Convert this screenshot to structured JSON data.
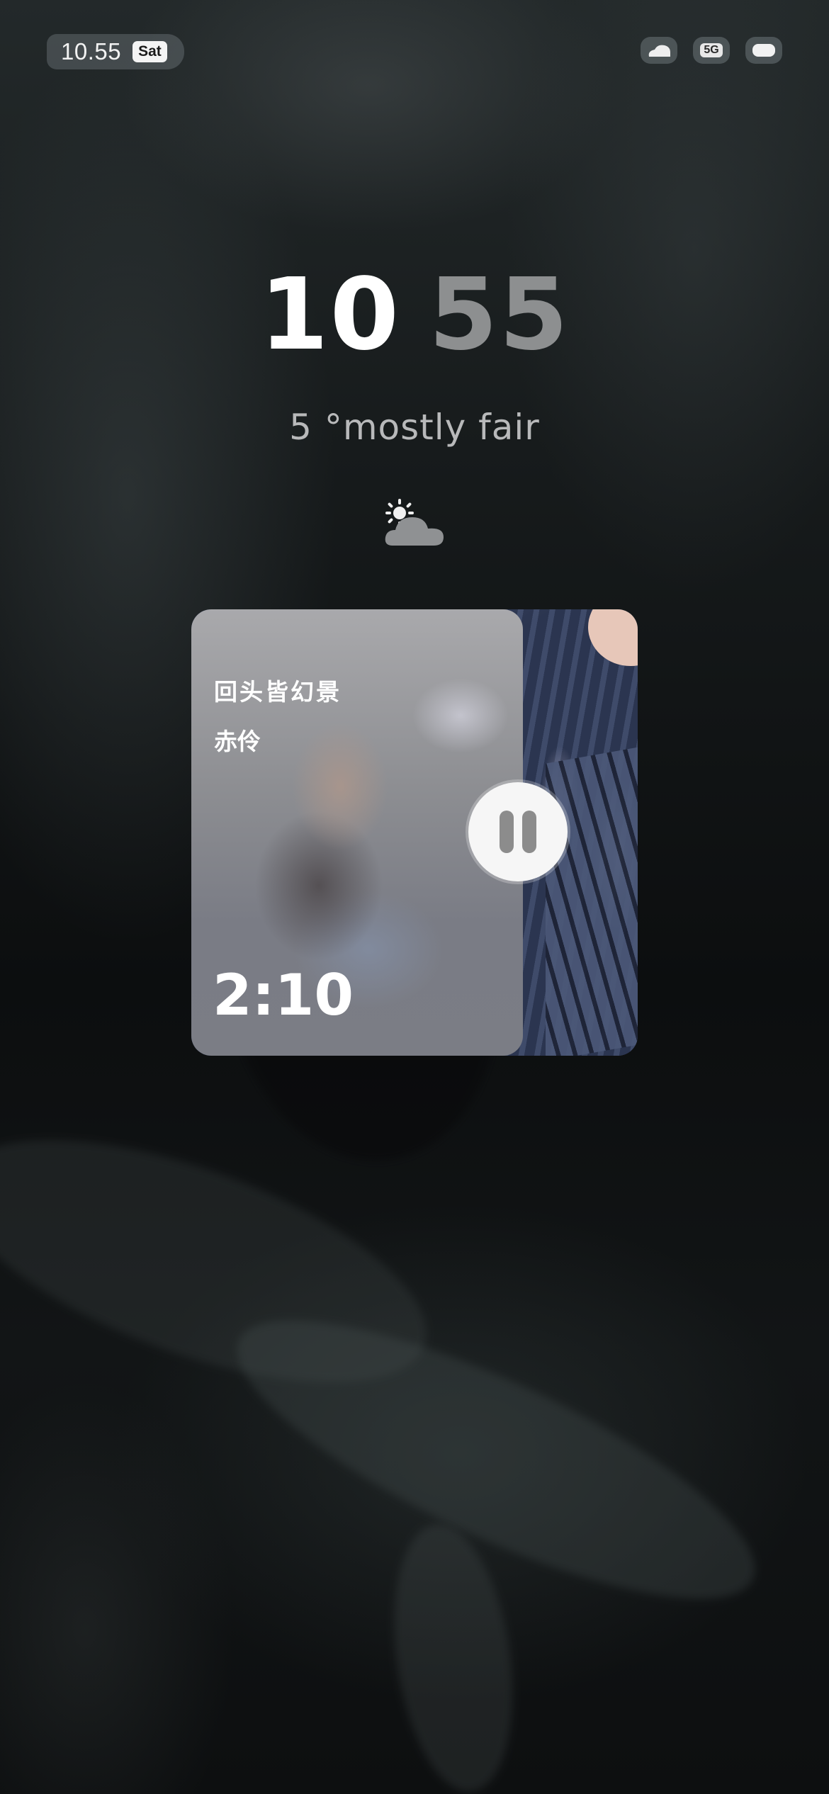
{
  "status_bar": {
    "time": "10.55",
    "day": "Sat",
    "network_label": "5G",
    "icons": [
      "cloud-icon",
      "5g-icon",
      "battery-icon"
    ]
  },
  "lockscreen": {
    "clock_hours": "10",
    "clock_minutes": "55",
    "weather_text": "5 °mostly fair",
    "weather_icon": "partly-cloudy-icon"
  },
  "music_widget": {
    "song_title": "回头皆幻景",
    "artist": "赤伶",
    "duration": "2:10",
    "control_icon": "pause-icon"
  }
}
